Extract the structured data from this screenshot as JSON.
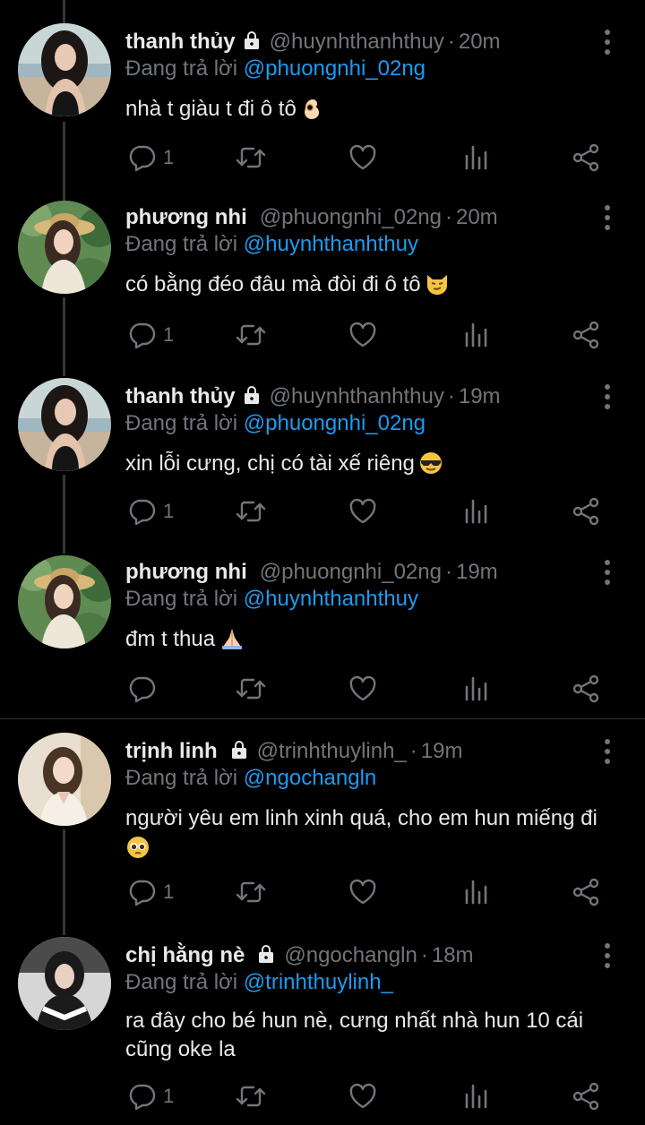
{
  "reply_prefix": "Đang trả lời",
  "tweets": [
    {
      "name": "thanh thủy",
      "handle": "@huynhthanhthuy",
      "time": "20m",
      "reply_to": "@phuongnhi_02ng",
      "text": "nhà t giàu t đi ô tô",
      "emoji": "ok-hand",
      "reply_count": "1",
      "protected": true
    },
    {
      "name": "phương nhi",
      "handle": "@phuongnhi_02ng",
      "time": "20m",
      "reply_to": "@huynhthanhthuy",
      "text": "có bằng đéo đâu mà đòi đi ô tô",
      "emoji": "smirk-cat",
      "reply_count": "1",
      "protected": false
    },
    {
      "name": "thanh thủy",
      "handle": "@huynhthanhthuy",
      "time": "19m",
      "reply_to": "@phuongnhi_02ng",
      "text": "xin lỗi cưng, chị có tài xế riêng",
      "emoji": "sunglasses",
      "reply_count": "1",
      "protected": true
    },
    {
      "name": "phương nhi",
      "handle": "@phuongnhi_02ng",
      "time": "19m",
      "reply_to": "@huynhthanhthuy",
      "text": "đm t thua",
      "emoji": "folded-hands",
      "reply_count": "",
      "protected": false
    },
    {
      "name": "trịnh linh",
      "handle": "@trinhthuylinh_",
      "time": "19m",
      "reply_to": "@ngochangln",
      "text_lines": [
        "người yêu em linh xinh quá, cho em hun miếng đi"
      ],
      "emoji": "pleading-face",
      "reply_count": "1",
      "protected": true
    },
    {
      "name": "chị hằng nè",
      "handle": "@ngochangln",
      "time": "18m",
      "reply_to": "@trinhthuylinh_",
      "text_lines": [
        "ra đây cho bé hun nè, cưng nhất nhà hun 10 cái",
        "cũng oke la"
      ],
      "reply_count": "1",
      "protected": true
    }
  ],
  "colors": {
    "background": "#000000",
    "text": "#e7e9ea",
    "muted": "#71767b",
    "link": "#1d9bf0",
    "divider": "#2f3336"
  },
  "icons": [
    "lock-icon",
    "more-icon",
    "reply-icon",
    "retweet-icon",
    "like-icon",
    "stats-icon",
    "share-icon"
  ]
}
